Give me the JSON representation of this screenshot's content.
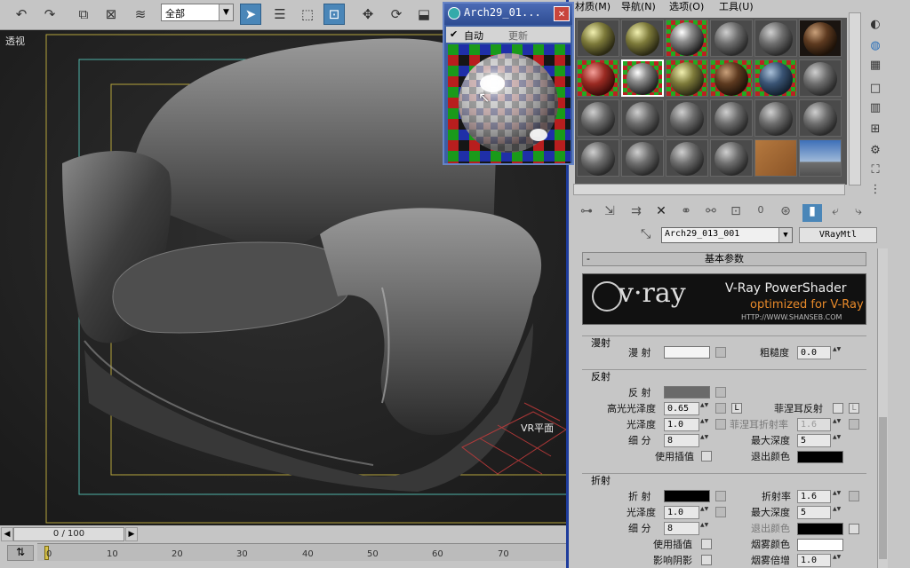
{
  "toolbar": {
    "selection_filter": "全部"
  },
  "viewport": {
    "label": "透视",
    "vr_plane_label": "VR平面"
  },
  "timeline": {
    "frame_readout": "0 / 100",
    "ticks": [
      "0",
      "10",
      "20",
      "30",
      "40",
      "50",
      "60",
      "70"
    ]
  },
  "preview_window": {
    "title": "Arch29_01...",
    "auto_label": "自动",
    "auto_checked": true,
    "update_label": "更新"
  },
  "material_editor": {
    "menu": [
      "材质(M)",
      "导航(N)",
      "选项(O)",
      "工具(U)"
    ],
    "material_name": "Arch29_013_001",
    "material_type": "VRayMtl",
    "rollout_title": "基本参数",
    "rollout_toggle": "-",
    "vray_banner": {
      "logo": "v·ray",
      "line1": "V-Ray PowerShader",
      "line2": "optimized for V-Ray",
      "url": "HTTP://WWW.SHANSEB.COM"
    },
    "diffuse_group": {
      "title": "漫射",
      "diffuse_label": "漫 射",
      "diffuse_color": "#f4f4f4",
      "roughness_label": "粗糙度",
      "roughness_value": "0.0"
    },
    "reflection_group": {
      "title": "反射",
      "reflect_label": "反 射",
      "reflect_color": "#6a6a6a",
      "hilight_gloss_label": "高光光泽度",
      "hilight_gloss_value": "0.65",
      "lock_label": "L",
      "fresnel_label": "菲涅耳反射",
      "fresnel_ior_label": "菲涅耳折射率",
      "fresnel_ior_value": "1.6",
      "fresnel_lock_label": "L",
      "gloss_label": "光泽度",
      "gloss_value": "1.0",
      "max_depth_label": "最大深度",
      "max_depth_value": "5",
      "subdivs_label": "细 分",
      "subdivs_value": "8",
      "exit_color_label": "退出颜色",
      "exit_color": "#000000",
      "interp_label": "使用插值"
    },
    "refraction_group": {
      "title": "折射",
      "refract_label": "折 射",
      "refract_color": "#000000",
      "ior_label": "折射率",
      "ior_value": "1.6",
      "gloss_label": "光泽度",
      "gloss_value": "1.0",
      "max_depth_label": "最大深度",
      "max_depth_value": "5",
      "subdivs_label": "细 分",
      "subdivs_value": "8",
      "exit_color_label": "退出颜色",
      "exit_color": "#000000",
      "interp_label": "使用插值",
      "fog_color_label": "烟雾颜色",
      "fog_color": "#ffffff",
      "shadows_label": "影响阴影",
      "fog_mult_label": "烟雾倍增",
      "fog_mult_value": "1.0"
    }
  }
}
